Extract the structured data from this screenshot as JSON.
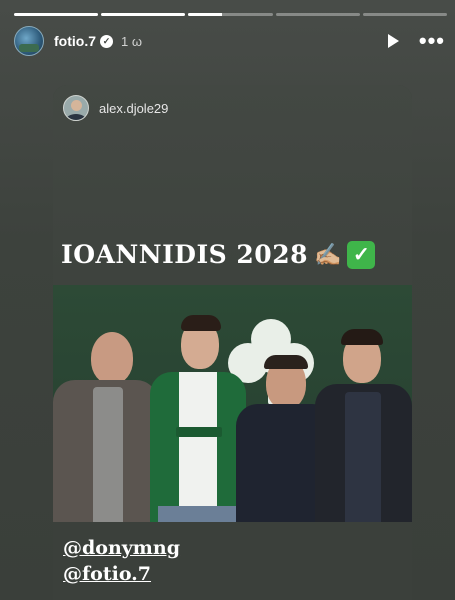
{
  "story": {
    "progress_segments": [
      1,
      1,
      0.4,
      0,
      0
    ],
    "username": "fotio.7",
    "verified_mark": "✓",
    "time_ago": "1 ω",
    "play_icon": "play-icon",
    "more_icon": "more-icon",
    "more_label": "•••"
  },
  "shared_post": {
    "username": "alex.djole29",
    "headline": "IOANNIDIS 2028",
    "headline_emoji_1": "✍🏼",
    "headline_emoji_2": "✓",
    "mentions": [
      "@donymng",
      "@fotio.7"
    ]
  },
  "colors": {
    "background": "#3f433f",
    "check_green": "#3fb54a",
    "wall_green": "#2d4a36"
  }
}
